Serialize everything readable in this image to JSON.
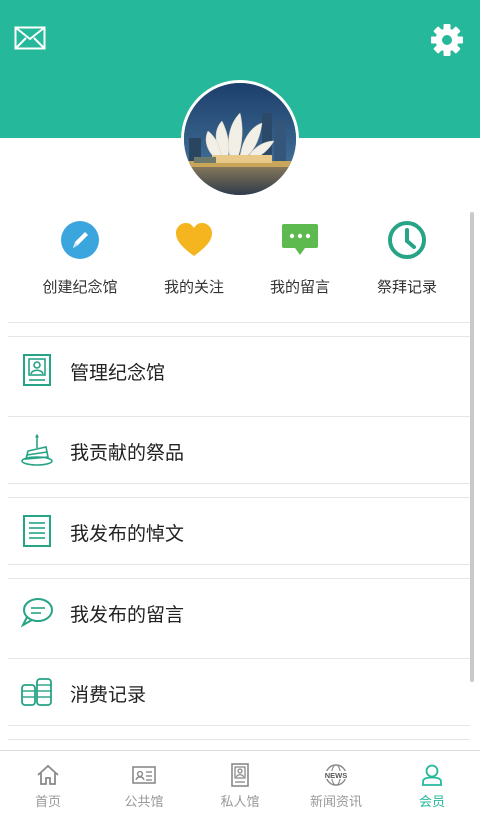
{
  "theme": {
    "accent": "#25b89a",
    "header_bg": "#25b89a",
    "tab_inactive": "#999999"
  },
  "header": {
    "left_icon": "mail-icon",
    "right_icon": "gear-icon"
  },
  "profile": {
    "avatar": "profile-photo"
  },
  "quick_actions": [
    {
      "label": "创建纪念馆",
      "icon": "edit-icon",
      "color": "#3aa6dd"
    },
    {
      "label": "我的关注",
      "icon": "heart-icon",
      "color": "#f5b51f"
    },
    {
      "label": "我的留言",
      "icon": "chat-icon",
      "color": "#5cba4f"
    },
    {
      "label": "祭拜记录",
      "icon": "clock-icon",
      "color": "#27a386"
    }
  ],
  "menu": [
    {
      "label": "管理纪念馆",
      "icon": "memorial-card-icon"
    },
    {
      "label": "我贡献的祭品",
      "icon": "cake-offering-icon"
    },
    {
      "label": "我发布的悼文",
      "icon": "document-icon"
    },
    {
      "label": "我发布的留言",
      "icon": "comment-icon"
    },
    {
      "label": "消费记录",
      "icon": "coins-icon"
    }
  ],
  "tabs": [
    {
      "label": "首页",
      "icon": "home-icon",
      "active": false
    },
    {
      "label": "公共馆",
      "icon": "public-hall-icon",
      "active": false
    },
    {
      "label": "私人馆",
      "icon": "private-hall-icon",
      "active": false
    },
    {
      "label": "新闻资讯",
      "icon": "news-icon",
      "active": false
    },
    {
      "label": "会员",
      "icon": "member-icon",
      "active": true
    }
  ]
}
